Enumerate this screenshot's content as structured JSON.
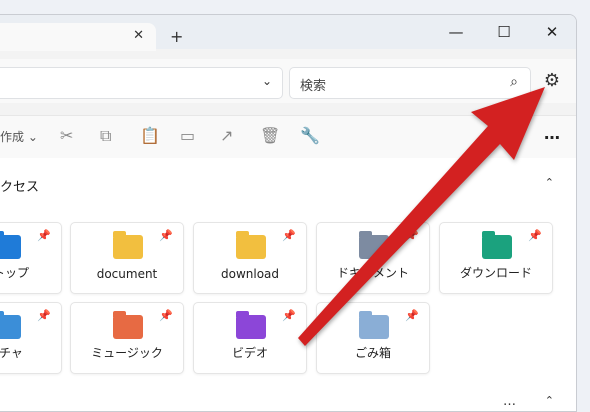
{
  "titlebar": {
    "tab_close": "✕",
    "new_tab": "+",
    "minimize": "—",
    "maximize": "☐",
    "close": "✕"
  },
  "navbar": {
    "chevron": "⌄",
    "search_placeholder": "検索",
    "search_icon": "⌕",
    "settings_icon": "⚙"
  },
  "toolbar": {
    "new_label": "作成 ⌄",
    "icons": [
      "cut-icon",
      "copy-icon",
      "paste-icon",
      "rename-icon",
      "share-icon",
      "delete-icon",
      "properties-icon"
    ],
    "more": "…"
  },
  "quick_access": {
    "title": "クセス",
    "collapse": "⌃",
    "items": [
      {
        "label": "クトップ",
        "icon": "desktop-icon",
        "color": "#1f7bd8"
      },
      {
        "label": "document",
        "icon": "folder-icon",
        "color": "#f2bf3f"
      },
      {
        "label": "download",
        "icon": "folder-icon",
        "color": "#f2bf3f"
      },
      {
        "label": "ドキュメント",
        "icon": "documents-folder-icon",
        "color": "#7d8ba1"
      },
      {
        "label": "ダウンロード",
        "icon": "downloads-folder-icon",
        "color": "#1ba27e"
      },
      {
        "label": "クチャ",
        "icon": "pictures-folder-icon",
        "color": "#3b8ed8"
      },
      {
        "label": "ミュージック",
        "icon": "music-folder-icon",
        "color": "#e76a43"
      },
      {
        "label": "ビデオ",
        "icon": "videos-folder-icon",
        "color": "#8c46d8"
      },
      {
        "label": "ごみ箱",
        "icon": "recycle-bin-icon",
        "color": "#8aaed6"
      }
    ]
  },
  "footer": {
    "more": "…",
    "collapse": "⌃"
  },
  "accent": "#d32121"
}
